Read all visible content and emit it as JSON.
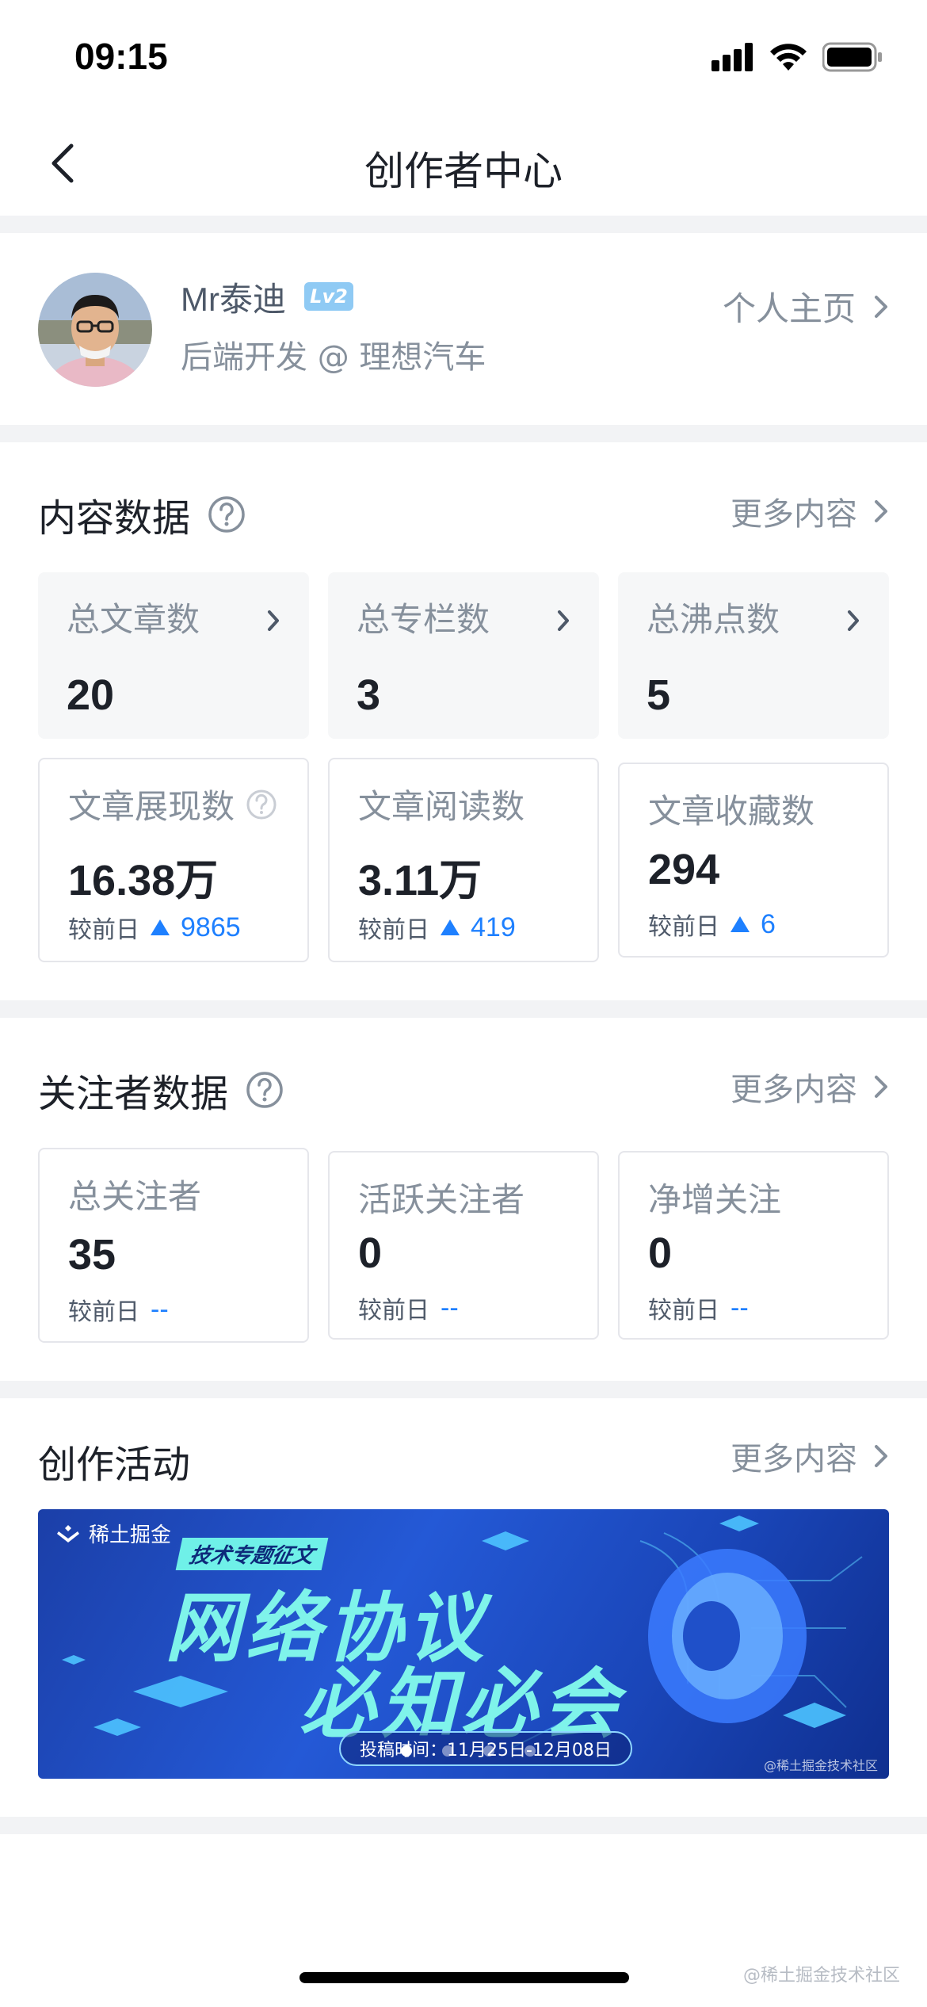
{
  "status_bar": {
    "time": "09:15"
  },
  "nav": {
    "title": "创作者中心"
  },
  "profile": {
    "name": "Mr泰迪",
    "level": "Lv2",
    "title": "后端开发 @ 理想汽车",
    "homepage_label": "个人主页"
  },
  "content_section": {
    "title": "内容数据",
    "more_label": "更多内容",
    "summary_cards": [
      {
        "label": "总文章数",
        "value": "20"
      },
      {
        "label": "总专栏数",
        "value": "3"
      },
      {
        "label": "总沸点数",
        "value": "5"
      }
    ],
    "stat_cards": [
      {
        "label": "文章展现数",
        "value": "16.38万",
        "compare_label": "较前日",
        "compare_value": "9865"
      },
      {
        "label": "文章阅读数",
        "value": "3.11万",
        "compare_label": "较前日",
        "compare_value": "419"
      },
      {
        "label": "文章收藏数",
        "value": "294",
        "compare_label": "较前日",
        "compare_value": "6"
      }
    ]
  },
  "follower_section": {
    "title": "关注者数据",
    "more_label": "更多内容",
    "cards": [
      {
        "label": "总关注者",
        "value": "35",
        "compare_label": "较前日",
        "compare_value": "--"
      },
      {
        "label": "活跃关注者",
        "value": "0",
        "compare_label": "较前日",
        "compare_value": "--"
      },
      {
        "label": "净增关注",
        "value": "0",
        "compare_label": "较前日",
        "compare_value": "--"
      }
    ]
  },
  "activity_section": {
    "title": "创作活动",
    "more_label": "更多内容",
    "banner": {
      "logo_text": "稀土掘金",
      "tag": "技术专题征文",
      "headline_1": "网络协议",
      "headline_2": "必知必会",
      "date_text": "投稿时间：11月25日-12月08日",
      "watermark": "@稀土掘金技术社区"
    }
  },
  "page_watermark": "@稀土掘金技术社区",
  "colors": {
    "accent": "#1e80ff",
    "muted": "#86909c",
    "divider": "#f2f3f5"
  }
}
